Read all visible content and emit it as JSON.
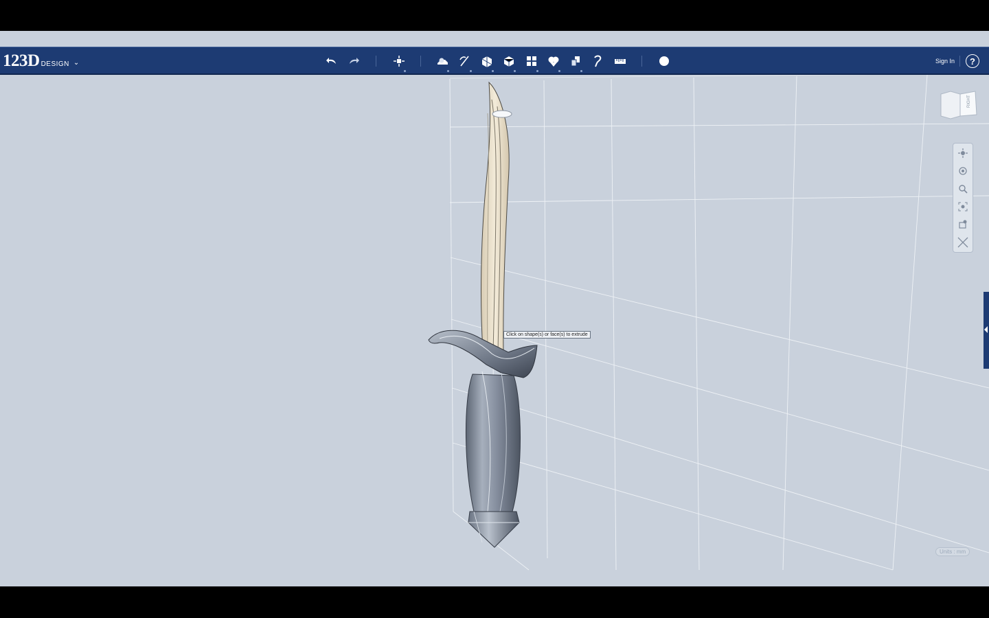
{
  "app": {
    "logo_main": "123D",
    "logo_sub": "DESIGN",
    "logo_chevron": "⌄"
  },
  "toolbar": {
    "groups": [
      [
        "undo-icon",
        "redo-icon"
      ],
      [
        "transform-icon"
      ],
      [
        "primitives-icon",
        "sketch-icon",
        "construct-icon",
        "modify-icon",
        "pattern-icon",
        "grouping-icon",
        "combine-icon",
        "snap-icon",
        "measure-icon"
      ],
      [
        "material-icon"
      ]
    ],
    "sign_in": "Sign In",
    "help": "?"
  },
  "viewport": {
    "viewcube_face": "RIGHT",
    "tooltip": "Click on shape(s) or face(s) to extrude",
    "units": "Units : mm",
    "nav_tools": [
      "pan-icon",
      "orbit-icon",
      "zoom-icon",
      "fit-icon",
      "look-at-icon",
      "perspective-icon"
    ]
  },
  "colors": {
    "toolbar_bg": "#1d3b73",
    "viewport_bg": "#c9d1dc",
    "grid_line": "#f2f5f8",
    "blade_fill": "#ece1cc",
    "handle_fill": "#7b8594"
  }
}
